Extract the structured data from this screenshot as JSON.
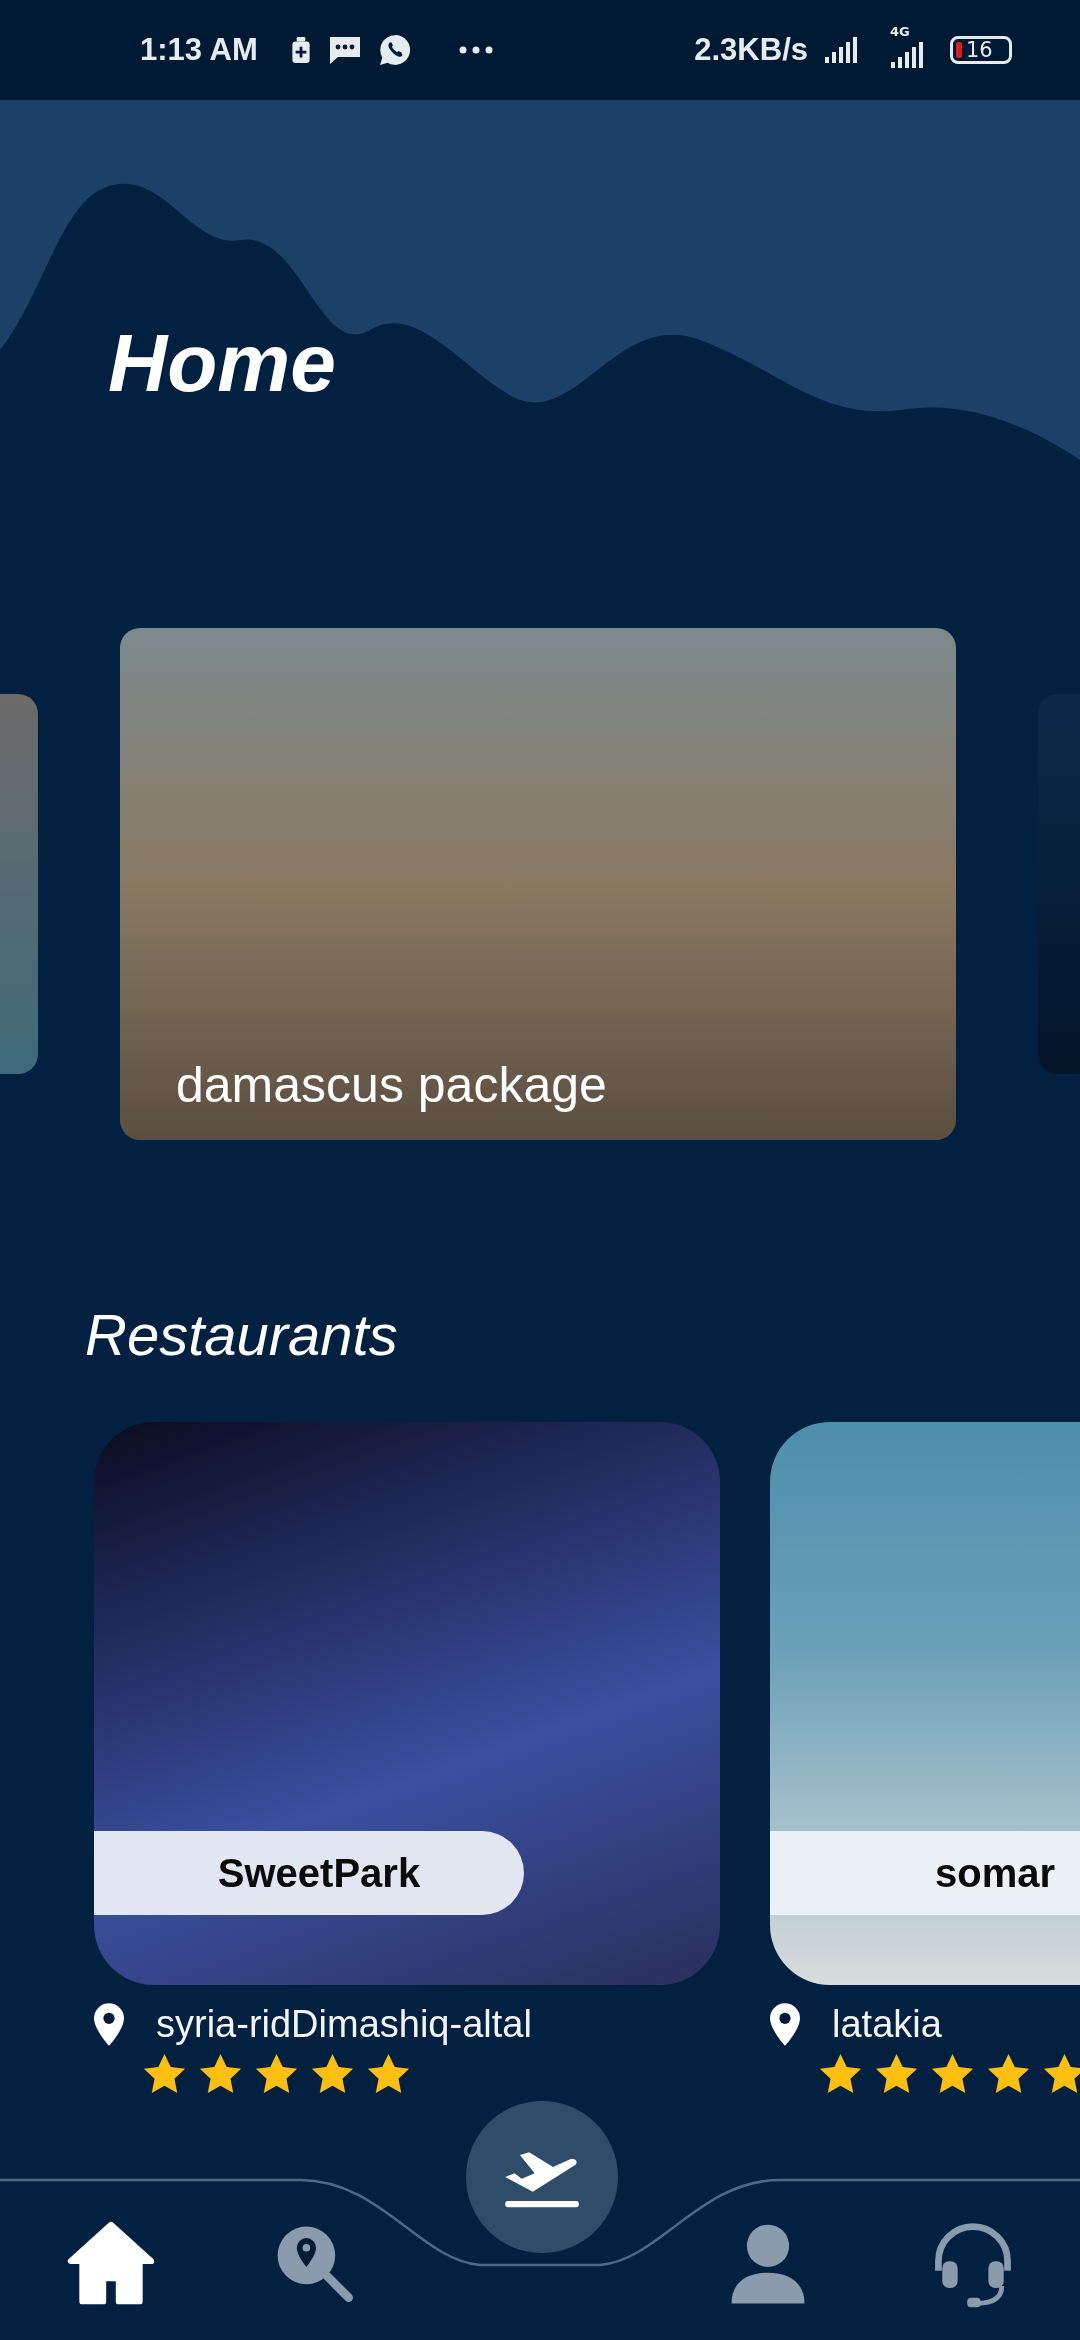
{
  "status_bar": {
    "time": "1:13 AM",
    "net_speed": "2.3KB/s",
    "network": "4G",
    "battery": "16"
  },
  "title": "Home",
  "packages": [
    {
      "kind": "side"
    },
    {
      "kind": "main",
      "title": "damascus package"
    },
    {
      "kind": "side"
    }
  ],
  "restaurants_title": "Restaurants",
  "restaurants": [
    {
      "name": "SweetPark",
      "location": "syria-ridDimashiq-altal",
      "stars": 5
    },
    {
      "name": "somar",
      "location": "latakia",
      "stars": 5
    }
  ],
  "nav": [
    {
      "kind": "home",
      "selected": true
    },
    {
      "kind": "search",
      "selected": false
    },
    {
      "kind": "flight"
    },
    {
      "kind": "profile",
      "selected": false
    },
    {
      "kind": "support",
      "selected": false
    }
  ]
}
